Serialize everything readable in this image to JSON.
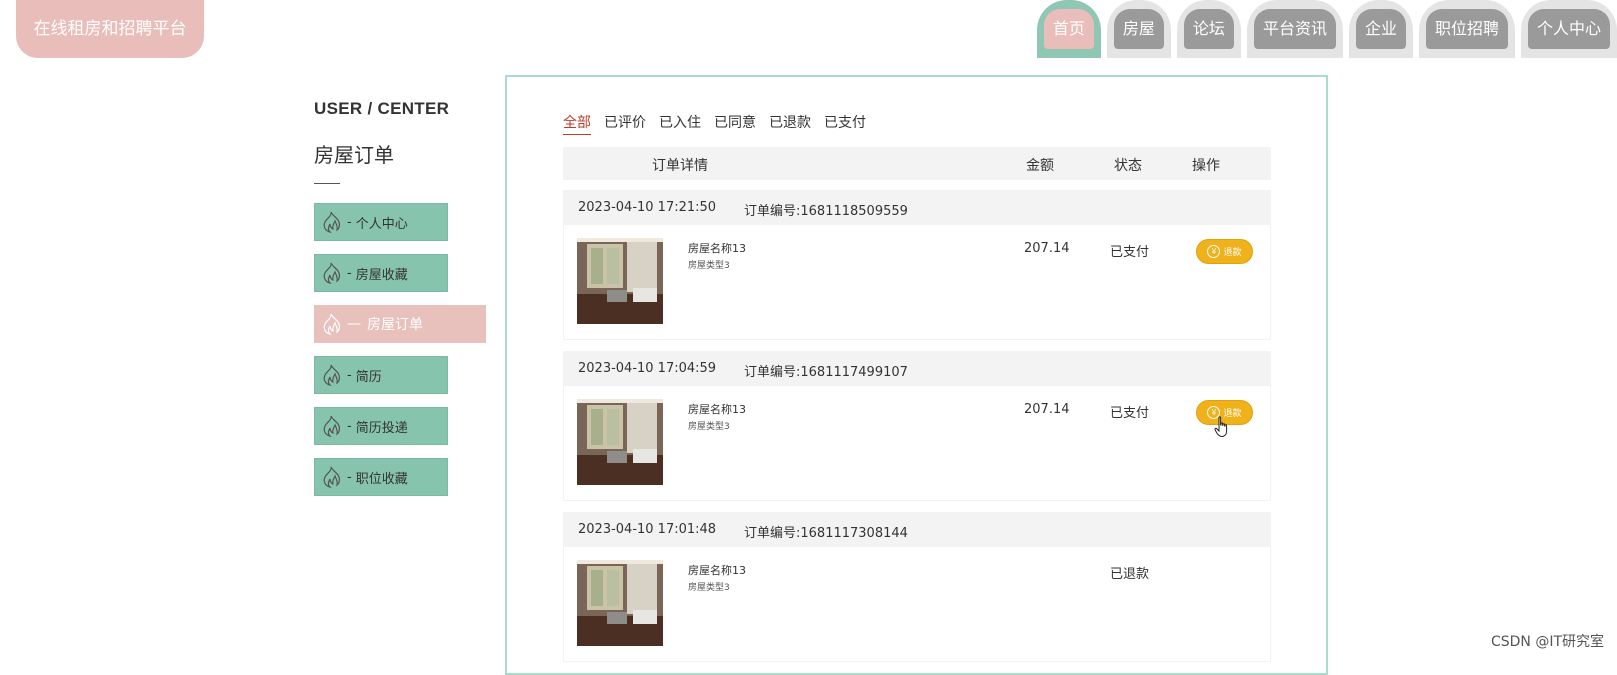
{
  "app": {
    "logo_text": "在线租房和招聘平台"
  },
  "nav": [
    {
      "label": "首页",
      "active": true
    },
    {
      "label": "房屋"
    },
    {
      "label": "论坛"
    },
    {
      "label": "平台资讯"
    },
    {
      "label": "企业"
    },
    {
      "label": "职位招聘"
    },
    {
      "label": "个人中心"
    }
  ],
  "sidebar": {
    "title_en": "USER / CENTER",
    "title_cn": "房屋订单",
    "items": [
      {
        "label": "个人中心",
        "dash": "-"
      },
      {
        "label": "房屋收藏",
        "dash": "-"
      },
      {
        "label": "房屋订单",
        "dash": "—",
        "active": true
      },
      {
        "label": "简历",
        "dash": "-"
      },
      {
        "label": "简历投递",
        "dash": "-"
      },
      {
        "label": "职位收藏",
        "dash": "-"
      }
    ]
  },
  "tabs": [
    {
      "label": "全部",
      "active": true
    },
    {
      "label": "已评价"
    },
    {
      "label": "已入住"
    },
    {
      "label": "已同意"
    },
    {
      "label": "已退款"
    },
    {
      "label": "已支付"
    }
  ],
  "table_header": {
    "detail": "订单详情",
    "amount": "金额",
    "status": "状态",
    "action": "操作"
  },
  "orders": [
    {
      "time": "2023-04-10 17:21:50",
      "order_no": "订单编号:1681118509559",
      "name": "房屋名称13",
      "type": "房屋类型3",
      "amount": "207.14",
      "status": "已支付",
      "action": "退款"
    },
    {
      "time": "2023-04-10 17:04:59",
      "order_no": "订单编号:1681117499107",
      "name": "房屋名称13",
      "type": "房屋类型3",
      "amount": "207.14",
      "status": "已支付",
      "action": "退款"
    },
    {
      "time": "2023-04-10 17:01:48",
      "order_no": "订单编号:1681117308144",
      "name": "房屋名称13",
      "type": "房屋类型3",
      "amount": "",
      "status": "已退款",
      "action": ""
    }
  ],
  "refund_icon": "yen-icon",
  "watermark": "CSDN @IT研究室",
  "colors": {
    "accent_pink": "#e9bdb9",
    "accent_green": "#86c4ad",
    "refund_yellow": "#efb21b",
    "tab_active": "#c0392b"
  }
}
